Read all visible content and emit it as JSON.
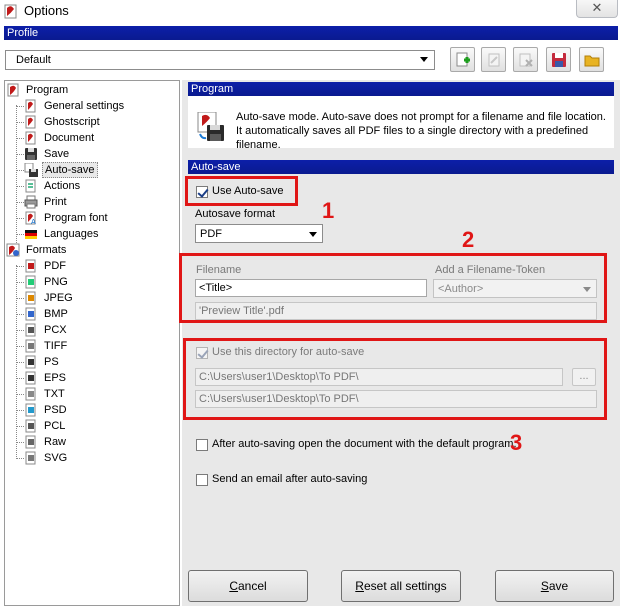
{
  "window": {
    "title": "Options",
    "close_glyph": "✕"
  },
  "profile": {
    "header": "Profile",
    "selected": "Default",
    "buttons": [
      "add-profile-icon",
      "rename-profile-icon",
      "delete-profile-icon",
      "save-profile-icon",
      "open-folder-icon"
    ]
  },
  "tree": {
    "program": "Program",
    "program_items": [
      {
        "label": "General settings",
        "icon": "settings-doc-icon"
      },
      {
        "label": "Ghostscript",
        "icon": "ghostscript-icon"
      },
      {
        "label": "Document",
        "icon": "document-icon"
      },
      {
        "label": "Save",
        "icon": "save-disk-icon"
      },
      {
        "label": "Auto-save",
        "icon": "auto-save-icon"
      },
      {
        "label": "Actions",
        "icon": "actions-icon"
      },
      {
        "label": "Print",
        "icon": "printer-icon"
      },
      {
        "label": "Program font",
        "icon": "font-icon"
      },
      {
        "label": "Languages",
        "icon": "language-flag-icon"
      }
    ],
    "formats": "Formats",
    "format_items": [
      "PDF",
      "PNG",
      "JPEG",
      "BMP",
      "PCX",
      "TIFF",
      "PS",
      "EPS",
      "TXT",
      "PSD",
      "PCL",
      "Raw",
      "SVG"
    ],
    "selected": "Auto-save"
  },
  "program_section": {
    "header": "Program",
    "description": "Auto-save mode. Auto-save does not prompt for a filename and file location. It automatically saves all PDF files to a single directory with a predefined filename."
  },
  "autosave": {
    "header": "Auto-save",
    "use_autosave_label": "Use Auto-save",
    "use_autosave_checked": true,
    "format_label": "Autosave format",
    "format_value": "PDF",
    "filename_label": "Filename",
    "filename_value": "<Title>",
    "token_label": "Add a Filename-Token",
    "token_value": "<Author>",
    "preview_value": "'Preview Title'.pdf",
    "use_dir_label": "Use this directory for auto-save",
    "use_dir_checked": true,
    "dir_value": "C:\\Users\\user1\\Desktop\\To PDF\\",
    "dir_preview": "C:\\Users\\user1\\Desktop\\To PDF\\",
    "browse_label": "...",
    "open_after_label": "After auto-saving open the document with the default program.",
    "open_after_checked": false,
    "send_email_label": "Send an email after auto-saving",
    "send_email_checked": false
  },
  "annotations": {
    "n1": "1",
    "n2": "2",
    "n3": "3",
    "color": "#e01616"
  },
  "buttons": {
    "cancel_first": "C",
    "cancel_rest": "ancel",
    "reset_first": "R",
    "reset_rest": "eset all settings",
    "save_first": "S",
    "save_rest": "ave"
  }
}
